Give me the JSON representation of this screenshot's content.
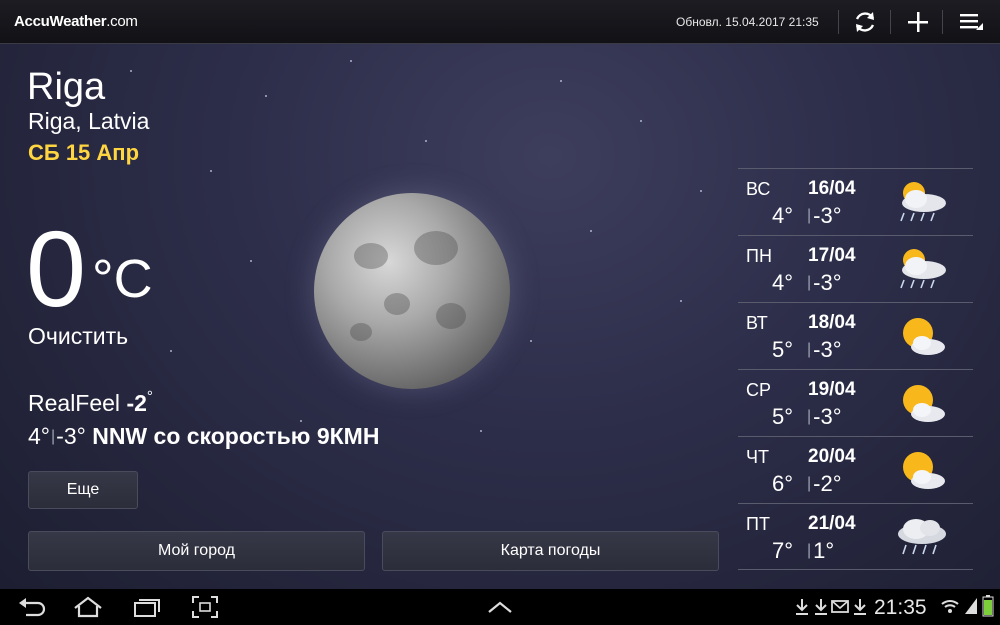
{
  "header": {
    "logo": "AccuWeather",
    "logo_suffix": ".com",
    "updated": "Обновл. 15.04.2017 21:35",
    "refresh_icon": "refresh-icon",
    "add_icon": "plus-icon",
    "menu_icon": "menu-icon"
  },
  "current": {
    "city": "Riga",
    "subtitle": "Riga, Latvia",
    "date": "СБ 15 Апр",
    "temp": "0",
    "unit": "°C",
    "condition": "Очистить",
    "realfeel_label": "RealFeel",
    "realfeel_value": "-2",
    "high": "4°",
    "low": "-3°",
    "wind": "NNW со скоростью 9КМН",
    "more_button": "Еще",
    "my_city_button": "Мой город",
    "weather_map_button": "Карта погоды"
  },
  "forecast": [
    {
      "day": "ВС",
      "date": "16/04",
      "high": "4°",
      "low": "-3°",
      "icon": "sun-cloud-rain-snow-icon"
    },
    {
      "day": "ПН",
      "date": "17/04",
      "high": "4°",
      "low": "-3°",
      "icon": "sun-cloud-rain-snow-icon"
    },
    {
      "day": "ВТ",
      "date": "18/04",
      "high": "5°",
      "low": "-3°",
      "icon": "sun-cloud-icon"
    },
    {
      "day": "СР",
      "date": "19/04",
      "high": "5°",
      "low": "-3°",
      "icon": "sun-cloud-icon"
    },
    {
      "day": "ЧТ",
      "date": "20/04",
      "high": "6°",
      "low": "-2°",
      "icon": "sun-cloud-icon"
    },
    {
      "day": "ПТ",
      "date": "21/04",
      "high": "7°",
      "low": "1°",
      "icon": "cloud-rain-snow-icon"
    }
  ],
  "system_bar": {
    "clock": "21:35",
    "colors": {
      "accent": "#ffd540",
      "battery": "#7ccf3a"
    }
  }
}
